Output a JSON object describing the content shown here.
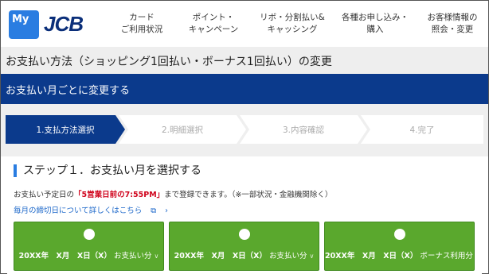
{
  "header": {
    "logo_my": "My",
    "logo_jcb": "JCB",
    "nav": [
      {
        "line1": "カード",
        "line2": "ご利用状況"
      },
      {
        "line1": "ポイント・",
        "line2": "キャンペーン"
      },
      {
        "line1": "リボ・分割払い&",
        "line2": "キャッシング"
      },
      {
        "line1": "各種お申し込み・",
        "line2": "購入"
      },
      {
        "line1": "お客様情報の",
        "line2": "照会・変更"
      }
    ]
  },
  "page_title": "お支払い方法（ショッピング1回払い・ボーナス1回払い）の変更",
  "section_title": "お支払い月ごとに変更する",
  "steps": [
    "1.支払方法選択",
    "2.明細選択",
    "3.内容確認",
    "4.完了"
  ],
  "colors": {
    "active_step": "#0b3a8c",
    "band": "#0b3a8c",
    "button": "#5aa82d",
    "deadline": "#d0021b"
  },
  "card": {
    "heading": "ステップ１．お支払い月を選択する",
    "desc_before": "お支払い予定日の",
    "desc_deadline": "「5営業日前の7:55PM」",
    "desc_after": "まで登録できます。（※一部状況・金融機関除く）",
    "link_text": "毎月の締切日について詳しくはこちら",
    "link_icons": [
      "external-link-icon",
      "chevron-right-icon"
    ],
    "options": [
      {
        "date": "20XX年　X月　X日（X）",
        "type": "お支払い分"
      },
      {
        "date": "20XX年　X月　X日（X）",
        "type": "お支払い分"
      },
      {
        "date": "20XX年　X月　X日（X）",
        "type": "ボーナス利用分"
      }
    ]
  }
}
